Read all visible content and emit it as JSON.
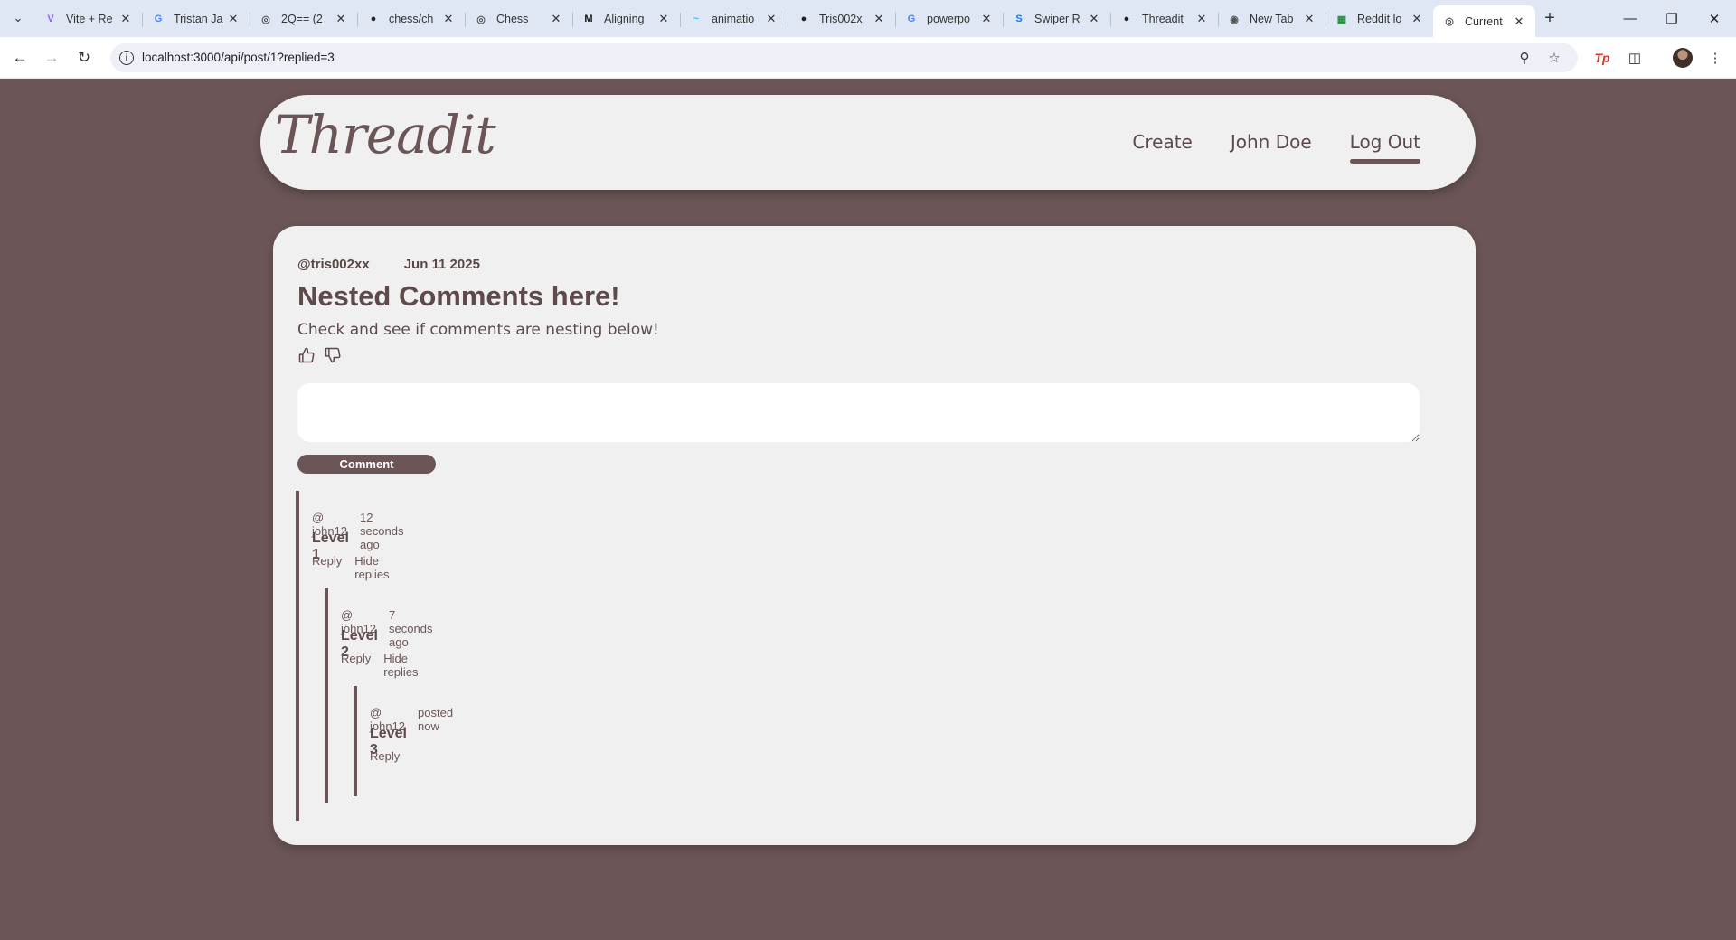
{
  "browser": {
    "tabs": [
      {
        "title": "Vite + Re",
        "favicon": "vite-icon",
        "color": "#8a63f2"
      },
      {
        "title": "Tristan Ja",
        "favicon": "google-icon",
        "color": "#4285f4"
      },
      {
        "title": "2Q== (2",
        "favicon": "globe-icon",
        "color": "#555555"
      },
      {
        "title": "chess/ch",
        "favicon": "github-icon",
        "color": "#222222"
      },
      {
        "title": "Chess",
        "favicon": "globe-icon",
        "color": "#555555"
      },
      {
        "title": "Aligning",
        "favicon": "medium-icon",
        "color": "#111111"
      },
      {
        "title": "animatio",
        "favicon": "tailwind-icon",
        "color": "#38bdf8"
      },
      {
        "title": "Tris002x",
        "favicon": "github-icon",
        "color": "#222222"
      },
      {
        "title": "powerpo",
        "favicon": "google-icon",
        "color": "#4285f4"
      },
      {
        "title": "Swiper R",
        "favicon": "swiper-icon",
        "color": "#0080ff"
      },
      {
        "title": "Threadit",
        "favicon": "github-icon",
        "color": "#222222"
      },
      {
        "title": "New Tab",
        "favicon": "chrome-icon",
        "color": "#555555"
      },
      {
        "title": "Reddit lo",
        "favicon": "sheets-icon",
        "color": "#1e8e3e"
      },
      {
        "title": "Current",
        "favicon": "globe-icon",
        "color": "#555555",
        "active": true
      }
    ],
    "url": "localhost:3000/api/post/1?replied=3"
  },
  "nav": {
    "logo": "Threadit",
    "links": [
      "Create",
      "John Doe",
      "Log Out"
    ],
    "active": "Log Out"
  },
  "post": {
    "author": "@tris002xx",
    "date": "Jun 11 2025",
    "title": "Nested Comments here!",
    "body": "Check and see if comments are nesting below!",
    "comment_placeholder": "",
    "comment_button": "Comment"
  },
  "comments": [
    {
      "user": "@ john12",
      "time": "12 seconds ago",
      "text": "Level 1",
      "reply": "Reply",
      "hide": "Hide replies"
    },
    {
      "user": "@ john12",
      "time": "7 seconds ago",
      "text": "Level 2",
      "reply": "Reply",
      "hide": "Hide replies"
    },
    {
      "user": "@ john12",
      "time": "posted now",
      "text": "Level 3",
      "reply": "Reply"
    }
  ],
  "colors": {
    "background": "#6b5556",
    "surface": "#f1f0f0",
    "accent": "#6b5556"
  }
}
